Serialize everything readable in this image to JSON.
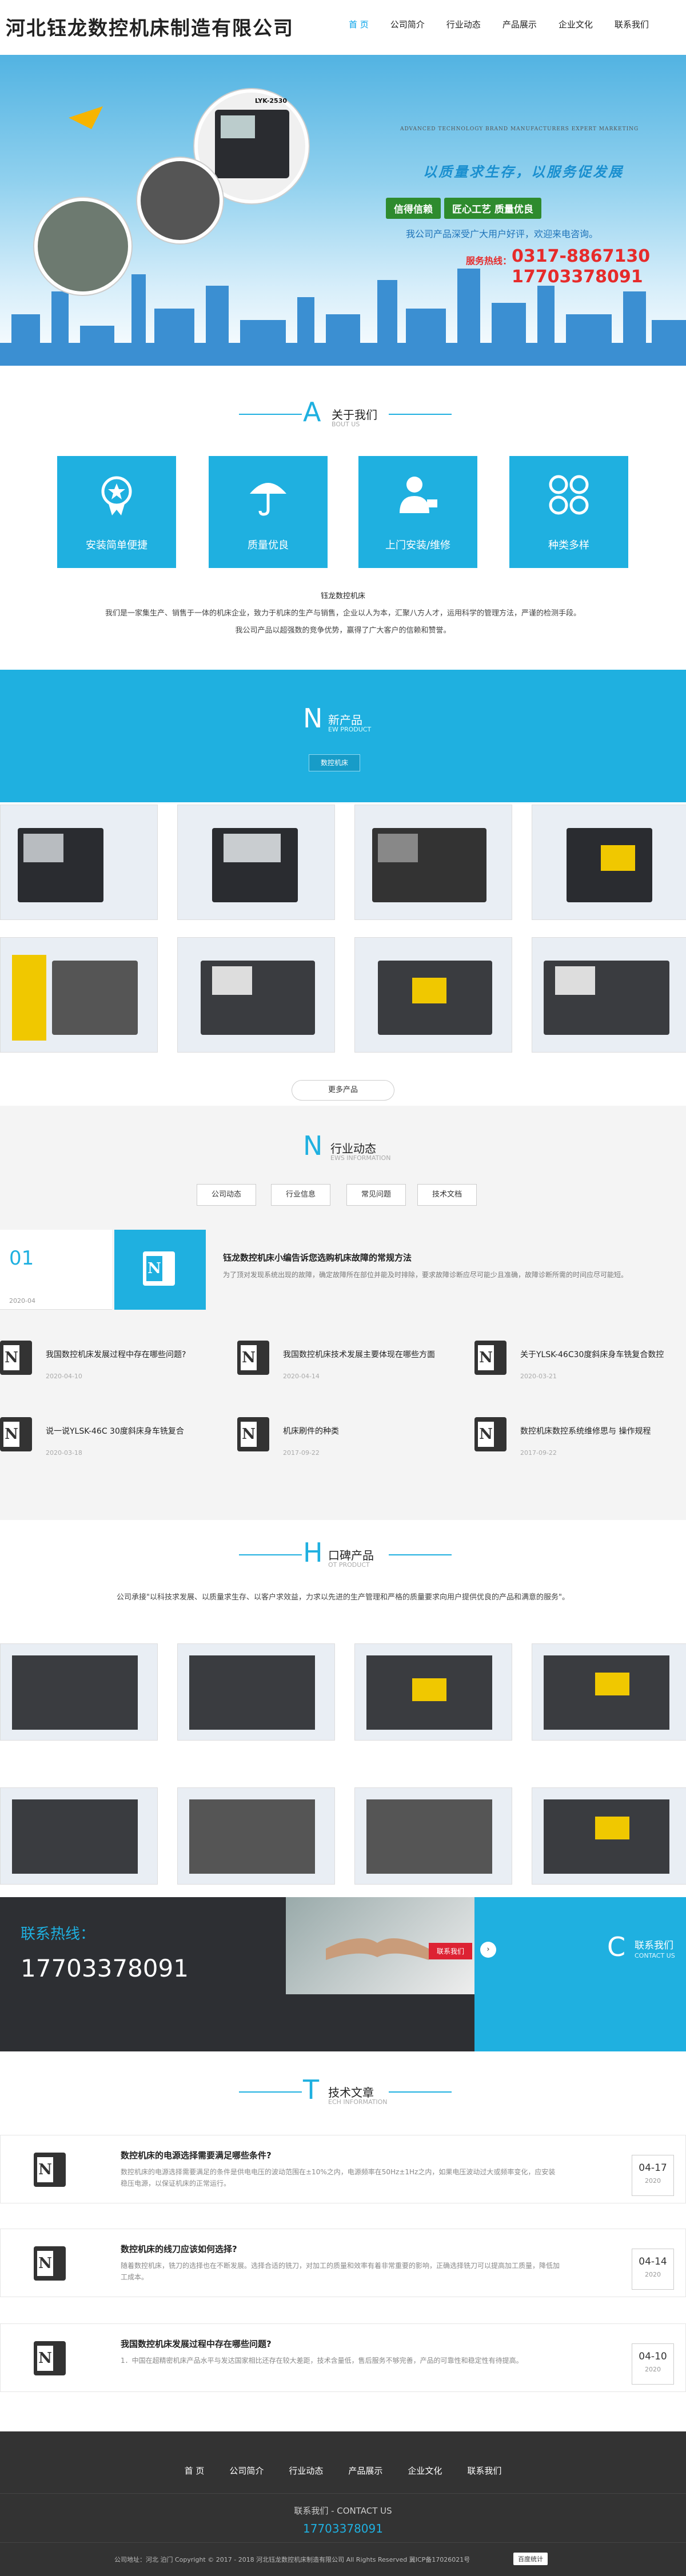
{
  "header": {
    "company_name": "河北钰龙数控机床制造有限公司",
    "nav": [
      "首 页",
      "公司简介",
      "行业动态",
      "产品展示",
      "企业文化",
      "联系我们"
    ]
  },
  "banner": {
    "english_line": "ADVANCED TECHNOLOGY BRAND MANUFACTURERS EXPERT MARKETING",
    "slogan": "以质量求生存，以服务促发展",
    "tags": [
      "信得信赖",
      "匠心工艺 质量优良"
    ],
    "note": "我公司产品深受广大用户好评，欢迎来电咨询。",
    "phone_label": "服务热线：",
    "phones": [
      "0317-8867130",
      "17703378091"
    ],
    "machine_badge": "LYK-2530"
  },
  "about": {
    "letter": "A",
    "title": "关于我们",
    "title_en": "BOUT US",
    "boxes": [
      {
        "label": "安装简单便捷",
        "icon": "badge-icon"
      },
      {
        "label": "质量优良",
        "icon": "umbrella-icon"
      },
      {
        "label": "上门安装/维修",
        "icon": "service-person-icon"
      },
      {
        "label": "种类多样",
        "icon": "clover-icon"
      }
    ],
    "subtitle": "钰龙数控机床",
    "para1": "我们是一家集生产、销售于一体的机床企业，致力于机床的生产与销售，企业以人为本，汇聚八方人才，运用科学的管理方法，严谨的检测手段。",
    "para2": "我公司产品以超强数的竞争优势，赢得了广大客户的信赖和赞誉。"
  },
  "products": {
    "letter": "N",
    "title": "新产品",
    "title_en": "EW PRODUCT",
    "category_button": "数控机床",
    "more_button": "更多产品"
  },
  "news": {
    "letter": "N",
    "title": "行业动态",
    "title_en": "EWS INFORMATION",
    "tabs": [
      "公司动态",
      "行业信息",
      "常见问题",
      "技术文档"
    ],
    "featured": {
      "day": "01",
      "date": "2020-04",
      "title": "钰龙数控机床小编告诉您选购机床故障的常规方法",
      "summary": "为了顶对发现系统出现的故障，确定故障所在部位并能及时排除，要求故障诊断应尽可能少且准确，故障诊断所需的时间应尽可能短。"
    },
    "items": [
      {
        "title": "我国数控机床发展过程中存在哪些问题?",
        "date": "2020-04-10"
      },
      {
        "title": "我国数控机床技术发展主要体现在哪些方面",
        "date": "2020-04-14"
      },
      {
        "title": "关于YLSK-46C30度斜床身车铣复合数控",
        "date": "2020-03-21"
      },
      {
        "title": "说一说YLSK-46C 30度斜床身车铣复合",
        "date": "2020-03-18"
      },
      {
        "title": "机床刷件的种类",
        "date": "2017-09-22"
      },
      {
        "title": "数控机床数控系统维修思与   操作规程",
        "date": "2017-09-22"
      }
    ]
  },
  "brand": {
    "letter": "H",
    "title": "口碑产品",
    "title_en": "OT PRODUCT",
    "intro": "公司承接\"以科技求发展、以质量求生存、以客户求效益，力求以先进的生产管理和严格的质量要求向用户提供优良的产品和满意的服务\"。"
  },
  "contact_band": {
    "label": "联系热线：",
    "phone": "17703378091",
    "button": "联系我们",
    "letter": "C",
    "title": "联系我们",
    "title_en": "CONTACT US"
  },
  "articles": {
    "letter": "T",
    "title": "技术文章",
    "title_en": "ECH INFORMATION",
    "list": [
      {
        "title": "数控机床的电源选择需要满足哪些条件?",
        "summary": "数控机床的电源选择需要满足的条件是供电电压的波动范围在±10%之内，电源频率在50Hz±1Hz之内，如果电压波动过大或频率变化，应安装稳压电源，以保证机床的正常运行。",
        "md": "04-17",
        "year": "2020"
      },
      {
        "title": "数控机床的线刀应该如何选择?",
        "summary": "随着数控机床，铣刀的选择也在不断发展。选择合适的铣刀，对加工的质量和效率有着非常重要的影响，正确选择铣刀可以提高加工质量，降低加工成本。",
        "md": "04-14",
        "year": "2020"
      },
      {
        "title": "我国数控机床发展过程中存在哪些问题?",
        "summary": "1．中国在超精密机床产品水平与发达国家相比还存在较大差距，技术含量低，售后服务不够完善，产品的可靠性和稳定性有待提高。",
        "md": "04-10",
        "year": "2020"
      }
    ]
  },
  "footer": {
    "nav": [
      "首 页",
      "公司简介",
      "行业动态",
      "产品展示",
      "企业文化",
      "联系我们"
    ],
    "contact_title": "联系我们 - CONTACT US",
    "phone": "17703378091",
    "copyright": "公司地址：河北 泊门 Copyright © 2017 - 2018 河北钰龙数控机床制造有限公司 All Rights Reserved 冀ICP备17026021号",
    "badge": "百度统计"
  },
  "colors": {
    "accent": "#1fb0e0",
    "red": "#e62b2b",
    "green": "#2e8b2e",
    "footer": "#333333"
  }
}
